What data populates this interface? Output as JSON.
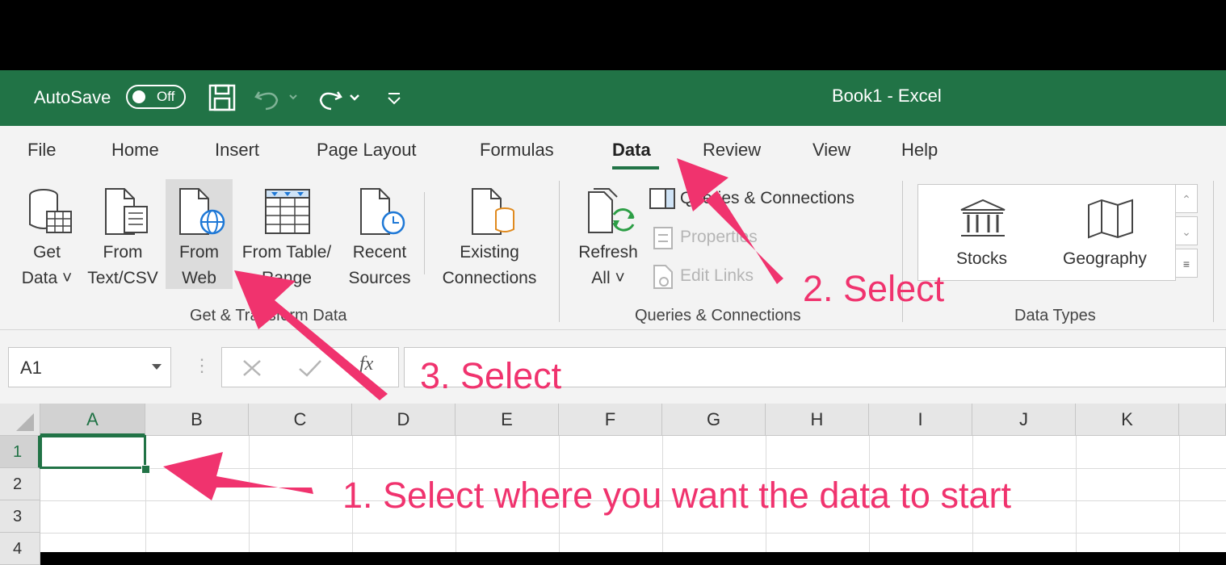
{
  "titlebar": {
    "autosave_label": "AutoSave",
    "autosave_state": "Off",
    "title": "Book1  -  Excel"
  },
  "tabs": [
    "File",
    "Home",
    "Insert",
    "Page Layout",
    "Formulas",
    "Data",
    "Review",
    "View",
    "Help"
  ],
  "active_tab": "Data",
  "ribbon": {
    "get_data": [
      "Get",
      "Data ˅"
    ],
    "from_text": [
      "From",
      "Text/CSV"
    ],
    "from_web": [
      "From",
      "Web"
    ],
    "from_table": [
      "From Table/",
      "Range"
    ],
    "recent_sources": [
      "Recent",
      "Sources"
    ],
    "existing_connections": [
      "Existing",
      "Connections"
    ],
    "group_get_transform": "Get & Transform Data",
    "refresh_all": [
      "Refresh",
      "All ˅"
    ],
    "queries_connections": "Queries & Connections",
    "properties": "Properties",
    "edit_links": "Edit Links",
    "group_queries": "Queries & Connections",
    "stocks": "Stocks",
    "geography": "Geography",
    "group_data_types": "Data Types"
  },
  "formula_bar": {
    "name_box": "A1",
    "fx": "fx",
    "value": ""
  },
  "grid": {
    "columns": [
      "A",
      "B",
      "C",
      "D",
      "E",
      "F",
      "G",
      "H",
      "I",
      "J",
      "K"
    ],
    "rows": [
      "1",
      "2",
      "3",
      "4"
    ],
    "selected_cell": "A1"
  },
  "annotations": {
    "step1": "1. Select where you want the data to start",
    "step2": "2. Select",
    "step3": "3. Select",
    "color": "#f0336e"
  },
  "colors": {
    "excel_green": "#217346",
    "ribbon_bg": "#f3f3f3"
  }
}
